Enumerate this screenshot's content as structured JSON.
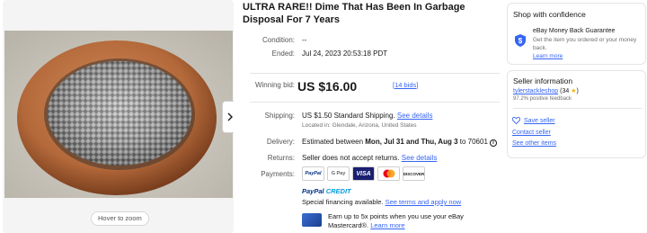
{
  "listing": {
    "title": "ULTRA RARE!! Dime That Has Been In Garbage Disposal For 7 Years",
    "condition_label": "Condition:",
    "condition_value": "--",
    "ended_label": "Ended:",
    "ended_value": "Jul 24, 2023 20:53:18 PDT",
    "winning_bid_label": "Winning bid:",
    "winning_bid_value": "US $16.00",
    "bids_prefix": "[",
    "bids_link": "14 bids",
    "bids_suffix": "]"
  },
  "gallery": {
    "hover_zoom": "Hover to zoom",
    "next_icon": "chevron-right-icon"
  },
  "shipping": {
    "label": "Shipping:",
    "cost": "US $1.50",
    "method": " Standard Shipping. ",
    "details_link": "See details",
    "location": "Located in: Glendale, Arizona, United States"
  },
  "delivery": {
    "label": "Delivery:",
    "prefix": "Estimated between ",
    "dates": "Mon, Jul 31 and Thu, Aug 3",
    "suffix": " to 70601",
    "info_icon": "info-icon"
  },
  "returns": {
    "label": "Returns:",
    "text": "Seller does not accept returns. ",
    "details_link": "See details"
  },
  "payments": {
    "label": "Payments:",
    "methods": [
      "PayPal",
      "G Pay",
      "VISA",
      "Mastercard",
      "DISCOVER"
    ],
    "paypal_credit_a": "PayPal",
    "paypal_credit_b": " CREDIT",
    "special_text": "Special financing available. ",
    "special_link": "See terms and apply now",
    "earn_text": "Earn up to 5x points when you use your eBay Mastercard®. ",
    "earn_link": "Learn more"
  },
  "confidence": {
    "heading": "Shop with confidence",
    "guarantee_title": "eBay Money Back Guarantee",
    "guarantee_desc": "Get the item you ordered or your money back.",
    "learn_more": "Learn more"
  },
  "seller": {
    "heading": "Seller information",
    "name": "tylerstackleshop",
    "score": " (34 ",
    "score_end": ")",
    "feedback": "97.2% positive feedback",
    "save_seller": "Save seller",
    "contact": "Contact seller",
    "other_items": "See other items"
  },
  "colors": {
    "link": "#3665f3",
    "text": "#191919",
    "muted": "#707070"
  }
}
